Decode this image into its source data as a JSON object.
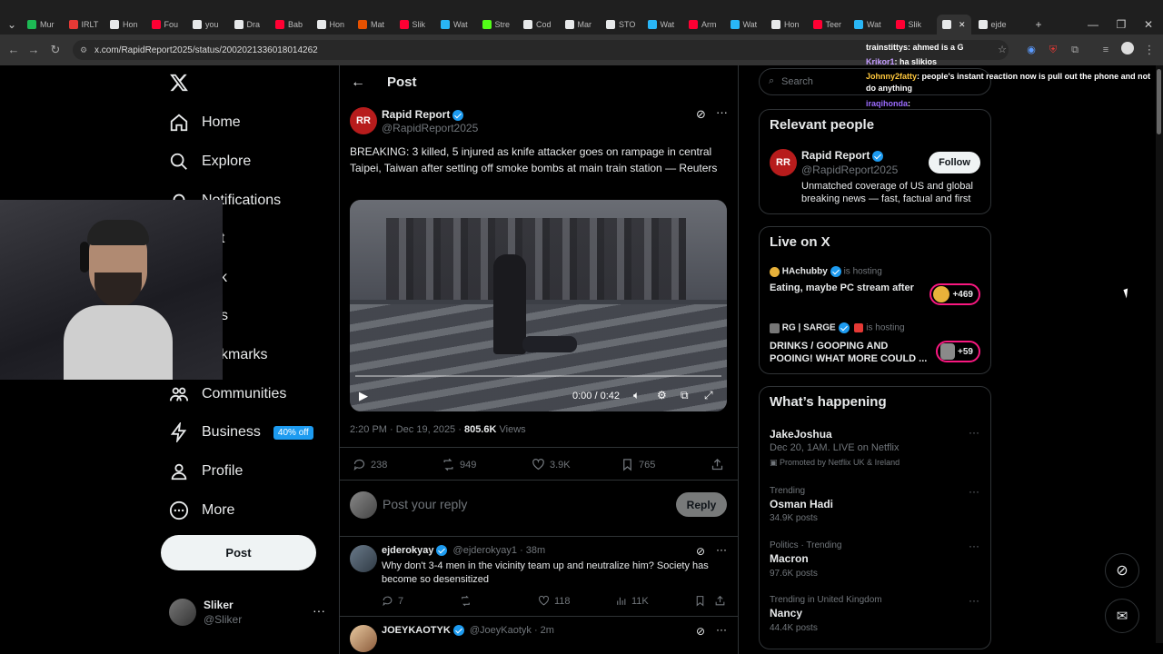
{
  "browser": {
    "tabs": [
      {
        "label": "Mur",
        "color": "#1db954"
      },
      {
        "label": "IRLT",
        "color": "#e53935"
      },
      {
        "label": "Hon",
        "color": "#e7e9ea"
      },
      {
        "label": "Fou",
        "color": "#ff0033"
      },
      {
        "label": "you",
        "color": "#e7e9ea"
      },
      {
        "label": "Dra",
        "color": "#e7e9ea"
      },
      {
        "label": "Bab",
        "color": "#ff0033"
      },
      {
        "label": "Hon",
        "color": "#e7e9ea"
      },
      {
        "label": "Mat",
        "color": "#e65100"
      },
      {
        "label": "Slik",
        "color": "#ff0033"
      },
      {
        "label": "Wat",
        "color": "#29b6f6"
      },
      {
        "label": "Stre",
        "color": "#53fc18"
      },
      {
        "label": "Cod",
        "color": "#e7e9ea"
      },
      {
        "label": "Mar",
        "color": "#e7e9ea"
      },
      {
        "label": "STO",
        "color": "#e7e9ea"
      },
      {
        "label": "Wat",
        "color": "#29b6f6"
      },
      {
        "label": "Arm",
        "color": "#ff0033"
      },
      {
        "label": "Wat",
        "color": "#29b6f6"
      },
      {
        "label": "Hon",
        "color": "#e7e9ea"
      },
      {
        "label": "Teer",
        "color": "#ff0033"
      },
      {
        "label": "Wat",
        "color": "#29b6f6"
      },
      {
        "label": "Slik",
        "color": "#ff0033"
      },
      {
        "label": "",
        "color": "#e7e9ea"
      },
      {
        "label": "ejde",
        "color": "#e7e9ea"
      }
    ],
    "url": "x.com/RapidReport2025/status/2002021336018014262"
  },
  "nav": {
    "home": "Home",
    "explore": "Explore",
    "notifications": "Notifications",
    "chat": "at",
    "grok": "k",
    "lists": "s",
    "bookmarks": "kmarks",
    "communities": "Communities",
    "business": "Business",
    "business_badge": "40% off",
    "profile": "Profile",
    "more": "More",
    "post": "Post",
    "account_name": "Sliker",
    "account_handle": "@Sliker"
  },
  "header": {
    "title": "Post"
  },
  "tweet": {
    "author": "Rapid Report",
    "handle": "@RapidReport2025",
    "avatar_text": "RR",
    "text": "BREAKING: 3 killed, 5 injured as knife attacker goes on rampage in central Taipei, Taiwan after setting off smoke bombs at main train station — Reuters",
    "video_time": "0:00 / 0:42",
    "timestamp": "2:20 PM · Dec 19, 2025 · ",
    "views_count": "805.6K",
    "views_label": " Views",
    "replies": "238",
    "reposts": "949",
    "likes": "3.9K",
    "bookmarks": "765"
  },
  "reply_box": {
    "placeholder": "Post your reply",
    "button": "Reply"
  },
  "replies": [
    {
      "name": "ejderokyay",
      "handle": "@ejderokyay1 · 38m",
      "text": "Why don't 3-4 men in the vicinity team up and neutralize him? Society has become so desensitized",
      "replies": "7",
      "likes": "118",
      "views": "11K"
    },
    {
      "name": "JOEYKAOTYK",
      "handle": "@JoeyKaotyk · 2m"
    }
  ],
  "search": {
    "placeholder": "Search"
  },
  "relevant": {
    "title": "Relevant people",
    "name": "Rapid Report",
    "handle": "@RapidReport2025",
    "bio": "Unmatched coverage of US and global breaking news — fast, factual and first",
    "follow": "Follow"
  },
  "live": {
    "title": "Live on X",
    "items": [
      {
        "host": "HAchubby",
        "status": "is hosting",
        "title": "Eating, maybe PC stream after",
        "count": "+469"
      },
      {
        "host": "RG | SARGE",
        "status": "is hosting",
        "title": "DRINKS / GOOPING AND POOING! WHAT MORE COULD ...",
        "count": "+59"
      }
    ]
  },
  "happening": {
    "title": "What’s happening",
    "items": [
      {
        "name": "JakeJoshua",
        "meta": "Dec 20, 1AM. LIVE on Netflix",
        "sub": "Promoted by Netflix UK & Ireland"
      },
      {
        "meta": "Trending",
        "name": "Osman Hadi",
        "sub": "34.9K posts"
      },
      {
        "meta": "Politics · Trending",
        "name": "Macron",
        "sub": "97.6K posts"
      },
      {
        "meta": "Trending in United Kingdom",
        "name": "Nancy",
        "sub": "44.4K posts"
      }
    ]
  },
  "chat_overlay": [
    {
      "user": "trainstittys",
      "msg": ": ahmed is a G",
      "color": "#ffffff"
    },
    {
      "user": "Krikor1",
      "msg": ": ha slikios",
      "color": "#c39bff"
    },
    {
      "user": "Johnny2fatty",
      "msg": ": people's instant reaction now is pull out the phone and not do anything",
      "color": "#ffc83d"
    },
    {
      "user": "iraqihonda",
      "msg": ":",
      "color": "#9c6cff"
    }
  ],
  "colors": {
    "accent": "#1d9bf0",
    "background": "#000000",
    "border": "#2f3336",
    "muted": "#71767b"
  }
}
